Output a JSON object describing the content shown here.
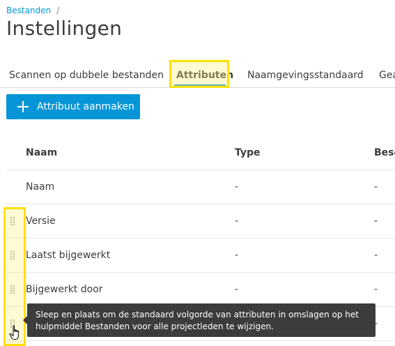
{
  "breadcrumb": {
    "items": [
      "Bestanden"
    ],
    "separator": "/"
  },
  "page": {
    "title": "Instellingen"
  },
  "tabs": [
    {
      "label": "Scannen op dubbele bestanden",
      "active": false
    },
    {
      "label": "Attributen",
      "active": true
    },
    {
      "label": "Naamgevingsstandaard",
      "active": false
    },
    {
      "label": "Gea",
      "active": false
    }
  ],
  "actions": {
    "add_attribute_label": "Attribuut aanmaken"
  },
  "table": {
    "columns": [
      "Naam",
      "Type",
      "Besc"
    ],
    "rows": [
      {
        "name": "Naam",
        "type": "-",
        "desc": "-",
        "draggable": false
      },
      {
        "name": "Versie",
        "type": "-",
        "desc": "-",
        "draggable": true
      },
      {
        "name": "Laatst bijgewerkt",
        "type": "-",
        "desc": "-",
        "draggable": true
      },
      {
        "name": "Bijgewerkt door",
        "type": "-",
        "desc": "-",
        "draggable": true
      },
      {
        "name": "",
        "type": "",
        "desc": "-",
        "draggable": true
      }
    ]
  },
  "tooltip": {
    "text": "Sleep en plaats om de standaard volgorde van attributen in omslagen op het hulpmiddel Bestanden voor alle projectleden te wijzigen."
  },
  "colors": {
    "accent": "#0696d7",
    "highlight": "#ffe100",
    "tooltip_bg": "#3c3c3c"
  }
}
